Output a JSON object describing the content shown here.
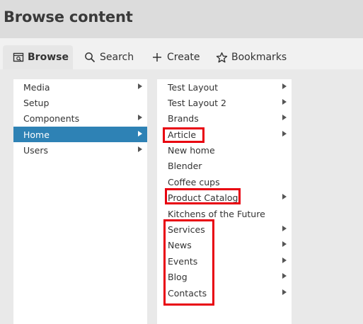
{
  "header": {
    "title": "Browse content"
  },
  "tabs": [
    {
      "label": "Browse",
      "icon": "browse-icon",
      "active": true
    },
    {
      "label": "Search",
      "icon": "search-icon"
    },
    {
      "label": "Create",
      "icon": "plus-icon"
    },
    {
      "label": "Bookmarks",
      "icon": "star-icon"
    }
  ],
  "left_column": {
    "items": [
      {
        "label": "Media",
        "has_children": true
      },
      {
        "label": "Setup",
        "has_children": false
      },
      {
        "label": "Components",
        "has_children": true
      },
      {
        "label": "Home",
        "has_children": true,
        "selected": true
      },
      {
        "label": "Users",
        "has_children": true
      }
    ]
  },
  "right_column": {
    "items": [
      {
        "label": "Test Layout",
        "has_children": true
      },
      {
        "label": "Test Layout 2",
        "has_children": true
      },
      {
        "label": "Brands",
        "has_children": true
      },
      {
        "label": "Article",
        "has_children": true
      },
      {
        "label": "New home",
        "has_children": false
      },
      {
        "label": "Blender",
        "has_children": false
      },
      {
        "label": "Coffee cups",
        "has_children": false
      },
      {
        "label": "Product Catalog",
        "has_children": true
      },
      {
        "label": "Kitchens of the Future",
        "has_children": false
      },
      {
        "label": "Services",
        "has_children": true
      },
      {
        "label": "News",
        "has_children": true
      },
      {
        "label": "Events",
        "has_children": true
      },
      {
        "label": "Blog",
        "has_children": true
      },
      {
        "label": "Contacts",
        "has_children": true
      }
    ]
  },
  "colors": {
    "selected": "#2e82b5",
    "highlight": "#e8000f"
  }
}
